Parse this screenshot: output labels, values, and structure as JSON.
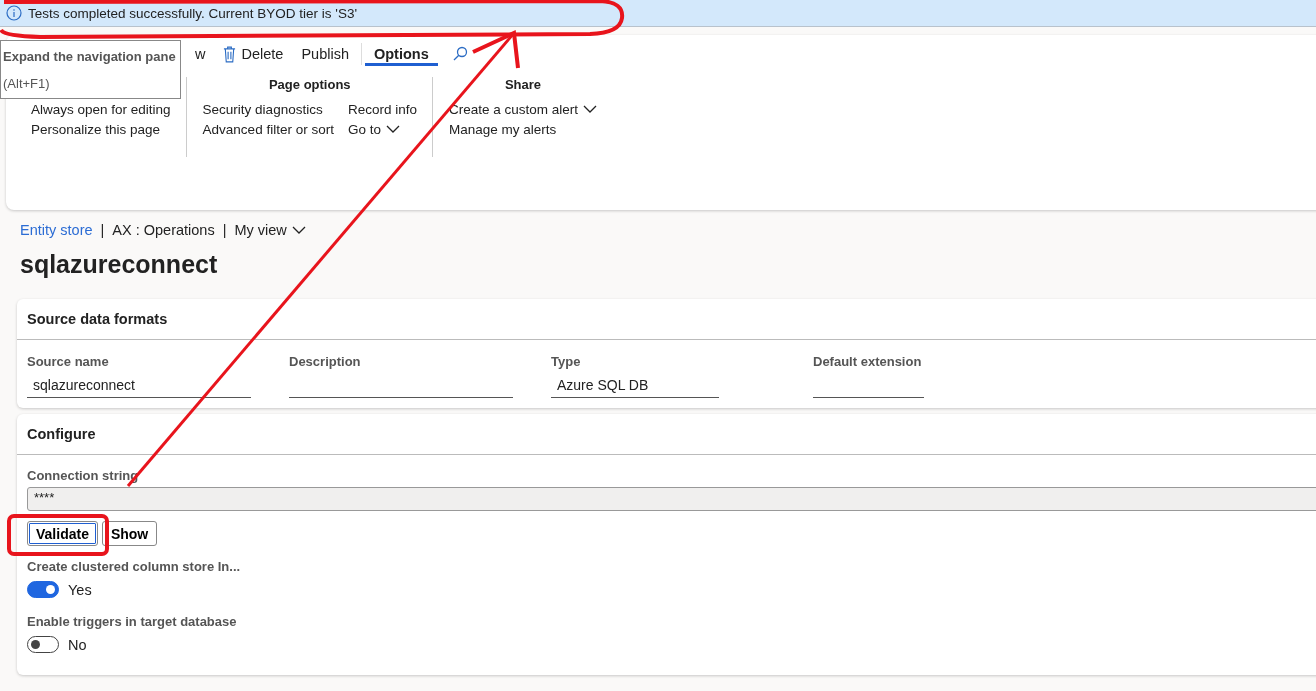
{
  "banner": {
    "text": "Tests completed successfully. Current BYOD tier is 'S3'"
  },
  "tooltip": {
    "title": "Expand the navigation pane",
    "shortcut": "(Alt+F1)"
  },
  "toolbar": {
    "items": [
      {
        "kind": "text",
        "label": "w",
        "selected": false
      },
      {
        "kind": "delete",
        "label": "Delete",
        "selected": false
      },
      {
        "kind": "text",
        "label": "Publish",
        "selected": false
      },
      {
        "kind": "tab",
        "label": "Options",
        "selected": true
      },
      {
        "kind": "search",
        "selected": false
      }
    ]
  },
  "ribbon": {
    "groups": [
      {
        "columns": [
          [
            {
              "label": "Always open for editing",
              "dropdown": false
            },
            {
              "label": "Personalize this page",
              "dropdown": false
            }
          ]
        ]
      },
      {
        "title": "Page options",
        "columns": [
          [
            {
              "label": "Security diagnostics",
              "dropdown": false
            },
            {
              "label": "Advanced filter or sort",
              "dropdown": false
            }
          ],
          [
            {
              "label": "Record info",
              "dropdown": false
            },
            {
              "label": "Go to",
              "dropdown": true
            }
          ]
        ]
      },
      {
        "title": "Share",
        "columns": [
          [
            {
              "label": "Create a custom alert",
              "dropdown": true
            },
            {
              "label": "Manage my alerts",
              "dropdown": false
            }
          ]
        ]
      }
    ]
  },
  "breadcrumb": [
    {
      "kind": "link",
      "label": "Entity store"
    },
    {
      "kind": "separator",
      "label": "|"
    },
    {
      "kind": "text",
      "label": "AX : Operations"
    },
    {
      "kind": "separator",
      "label": "|"
    },
    {
      "kind": "dropdown",
      "label": "My view"
    }
  ],
  "page_title": "sqlazureconnect",
  "source_section": {
    "title": "Source data formats",
    "fields": [
      {
        "label": "Source name",
        "value": "sqlazureconnect"
      },
      {
        "label": "Description"
      },
      {
        "label": "Type",
        "value": "Azure SQL DB"
      },
      {
        "label": "Default extension"
      }
    ]
  },
  "configure_section": {
    "title": "Configure",
    "connection": {
      "label": "Connection string",
      "value": "****"
    },
    "buttons": [
      {
        "label": "Validate",
        "focused": true
      },
      {
        "label": "Show",
        "focused": false
      }
    ],
    "toggles": [
      {
        "label": "Create clustered column store In...",
        "on": true,
        "state_text": "Yes"
      },
      {
        "label": "Enable triggers in target database",
        "on": false,
        "state_text": "No"
      }
    ]
  }
}
